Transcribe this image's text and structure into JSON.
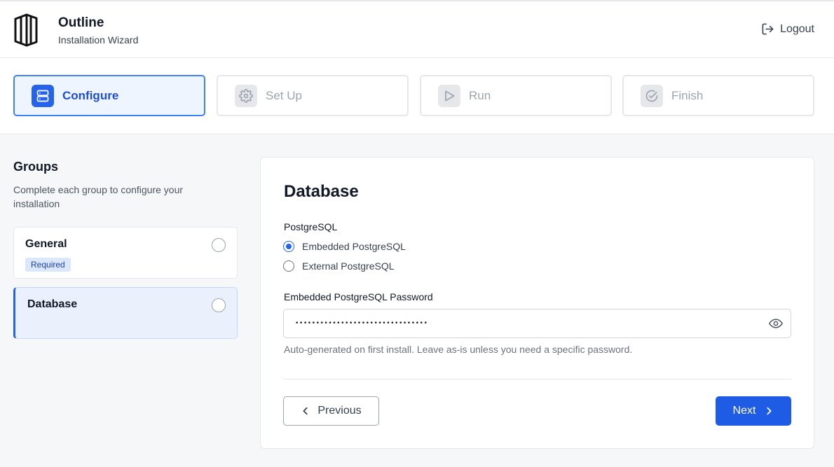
{
  "header": {
    "title": "Outline",
    "subtitle": "Installation Wizard",
    "logout_label": "Logout"
  },
  "steps": [
    {
      "label": "Configure",
      "icon": "server-icon",
      "active": true
    },
    {
      "label": "Set Up",
      "icon": "gear-icon",
      "active": false
    },
    {
      "label": "Run",
      "icon": "play-icon",
      "active": false
    },
    {
      "label": "Finish",
      "icon": "check-circle-icon",
      "active": false
    }
  ],
  "sidebar": {
    "title": "Groups",
    "description": "Complete each group to configure your installation",
    "groups": [
      {
        "name": "General",
        "badge": "Required",
        "active": false
      },
      {
        "name": "Database",
        "active": true
      }
    ]
  },
  "main": {
    "title": "Database",
    "postgres_label": "PostgreSQL",
    "options": [
      {
        "label": "Embedded PostgreSQL",
        "checked": true
      },
      {
        "label": "External PostgreSQL",
        "checked": false
      }
    ],
    "password_label": "Embedded PostgreSQL Password",
    "password_value": "••••••••••••••••••••••••••••••••",
    "help_text": "Auto-generated on first install. Leave as-is unless you need a specific password.",
    "previous_label": "Previous",
    "next_label": "Next"
  },
  "colors": {
    "accent": "#2563eb",
    "primary_button": "#1f5ce6",
    "active_bg": "#eaf1fd"
  }
}
